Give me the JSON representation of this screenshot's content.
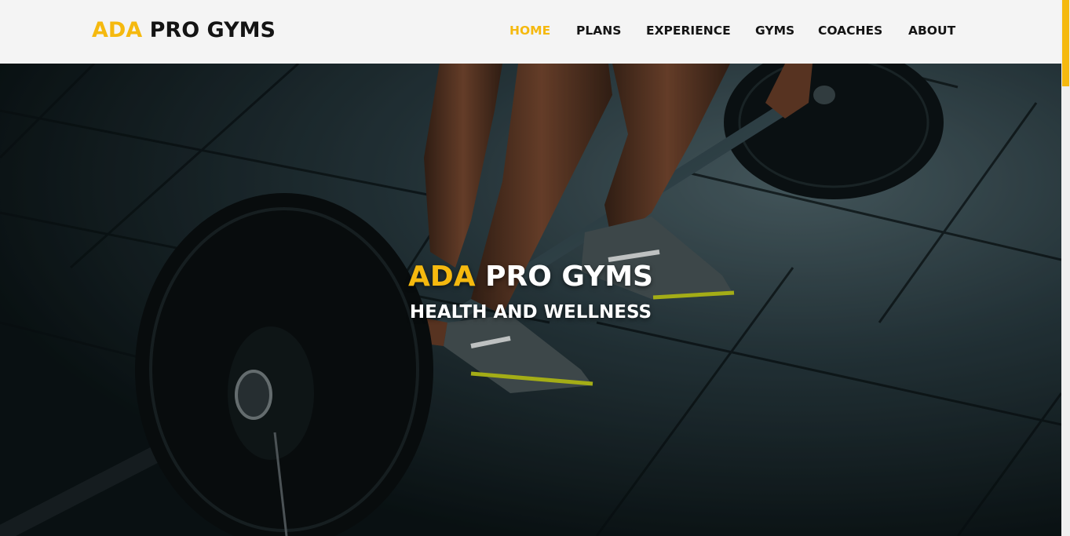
{
  "brand": {
    "accent": "ADA",
    "rest": " PRO GYMS"
  },
  "nav": {
    "items": [
      {
        "label": "HOME",
        "active": true
      },
      {
        "label": "PLANS",
        "active": false
      },
      {
        "label": "EXPERIENCE",
        "active": false
      },
      {
        "label": "GYMS",
        "active": false
      },
      {
        "label": "COACHES",
        "active": false
      },
      {
        "label": "ABOUT",
        "active": false
      }
    ]
  },
  "hero": {
    "title_accent": "ADA",
    "title_rest": " PRO GYMS",
    "subtitle": "HEALTH AND WELLNESS",
    "image": "deadlift-barbell-photo"
  },
  "colors": {
    "accent": "#f5b90f",
    "nav_background": "#f4f4f4",
    "nav_text": "#141414",
    "hero_text": "#ffffff"
  }
}
